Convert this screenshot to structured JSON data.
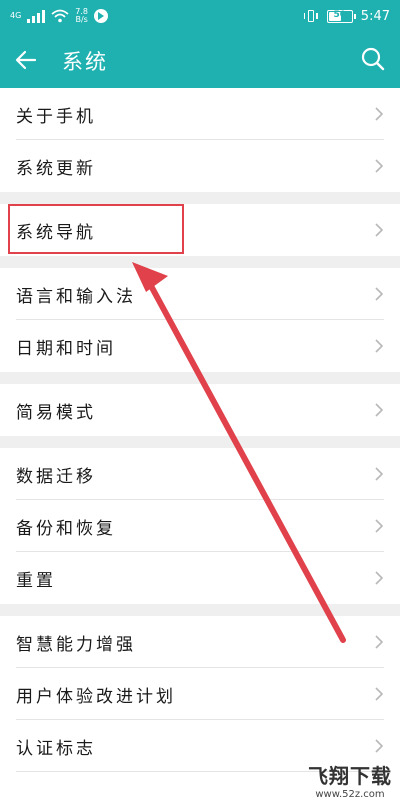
{
  "status_bar": {
    "network": "4G",
    "speed_value": "7.8",
    "speed_unit": "B/s",
    "time": "5:47",
    "battery_percent": "50"
  },
  "title_bar": {
    "title": "系统",
    "back_icon": "arrow-left-icon",
    "search_icon": "search-icon"
  },
  "groups": [
    {
      "items": [
        "关于手机",
        "系统更新"
      ]
    },
    {
      "items": [
        "系统导航"
      ]
    },
    {
      "items": [
        "语言和输入法",
        "日期和时间"
      ]
    },
    {
      "items": [
        "简易模式"
      ]
    },
    {
      "items": [
        "数据迁移",
        "备份和恢复",
        "重置"
      ]
    },
    {
      "items": [
        "智慧能力增强",
        "用户体验改进计划",
        "认证标志"
      ]
    }
  ],
  "annotation": {
    "highlighted_item": "系统导航",
    "color": "#e0414a"
  },
  "watermark": {
    "main": "飞翔下载",
    "sub": "www.52z.com"
  },
  "colors": {
    "accent": "#1fb0b0",
    "background": "#ffffff",
    "group_gap": "#efefef"
  }
}
